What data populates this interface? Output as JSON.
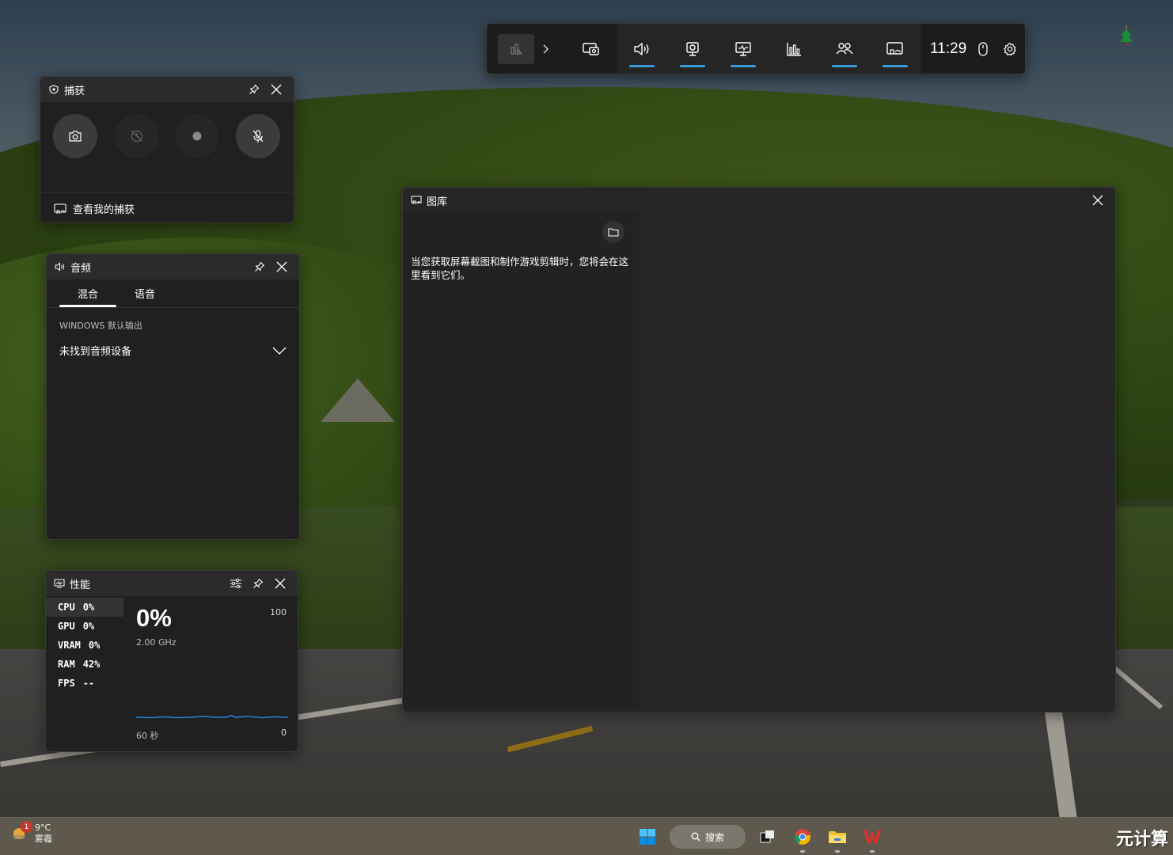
{
  "gamebar": {
    "time": "11:29",
    "widgets": [
      "widget-capture",
      "widget-audio",
      "widget-performance",
      "widget-resources",
      "widget-xbox-social",
      "widget-gallery"
    ]
  },
  "capture": {
    "title": "捕获",
    "view_captures": "查看我的捕获"
  },
  "audio": {
    "title": "音频",
    "tabs": [
      "混合",
      "语音"
    ],
    "section_label": "WINDOWS 默认输出",
    "device": "未找到音频设备"
  },
  "performance": {
    "title": "性能",
    "metrics": [
      {
        "label": "CPU",
        "value": "0%"
      },
      {
        "label": "GPU",
        "value": "0%"
      },
      {
        "label": "VRAM",
        "value": "0%"
      },
      {
        "label": "RAM",
        "value": "42%"
      },
      {
        "label": "FPS",
        "value": "--"
      }
    ],
    "big_value": "0%",
    "frequency": "2.00 GHz",
    "max": "100",
    "min": "0",
    "window": "60 秒"
  },
  "gallery": {
    "title": "图库",
    "message": "当您获取屏幕截图和制作游戏剪辑时，您将会在这里看到它们。"
  },
  "taskbar": {
    "temperature": "9°C",
    "weather": "雾霾",
    "notification_count": "1",
    "search_label": "搜索"
  },
  "watermark": "元计算",
  "colors": {
    "accent": "#3a9bdc",
    "panel_bg": "#202020",
    "header_bg": "#2b2b2b"
  }
}
